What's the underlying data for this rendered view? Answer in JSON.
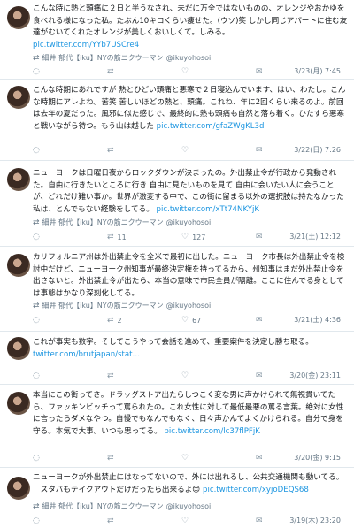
{
  "tweets": [
    {
      "text": "こんな時に熱と頭痛に２日と半うなされ、未だに万全ではないものの、オレンジやおかゆを食べれる様になった私。たぶん10キロくらい痩せた。(ウソ)笑 しかし同じアパートに住む友達がむいてくれたオレンジが美しくおいしくて。しみる。",
      "link": "pic.twitter.com/YYb7USCre4",
      "retweeter": "細井 郁代【iku】NYの筋ニクウーマン",
      "handle": "@ikuyohosoi",
      "date": "3/23(月) 7:45",
      "replies": "",
      "retweets": "",
      "likes": ""
    },
    {
      "text": "こんな時期にあれですが 熱とひどい頭痛と悪寒で２日寝込んでいます、はい、わたし。こんな時期にアレよね。苦笑 苦しいほどの熱と、頭痛。これね、年に2回くらい来るのよ。前回は去年の夏だった。風邪に似た感じで、最終的に熱も頭痛も自然と落ち着く。ひたすら悪寒と戦いながら待つ。もう山は越した ",
      "link": "pic.twitter.com/gfaZWgKL3d",
      "retweeter": "",
      "handle": "",
      "date": "3/22(日) 7:26",
      "replies": "",
      "retweets": "",
      "likes": ""
    },
    {
      "text": "ニューヨークは日曜日夜からロックダウンが決まったの。外出禁止令が行政から発動された。自由に行きたいところに行き 自由に見たいものを見て 自由に会いたい人に会うことが、どれだけ難い事か。世界が激変する中で、この街に留まる以外の選択肢は持たなかった私は、とんでもない経験をしてる。 ",
      "link": "pic.twitter.com/xTt74NKYjK",
      "retweeter": "細井 郁代【iku】NYの筋ニクウーマン",
      "handle": "@ikuyohosoi",
      "date": "3/21(土) 12:12",
      "replies": "",
      "retweets": "11",
      "likes": "127"
    },
    {
      "text": "カリフォルニア州は外出禁止令を全米で最初に出した。ニューヨーク市長は外出禁止令を検討中だけど、ニューヨーク州知事が最終決定権を持ってるから、州知事はまだ外出禁止令を出さないと。外出禁止令が出たら、本当の意味で市民全員が隔離。ここに住んでる身としては事態はかなり深刻化してる。",
      "link": "",
      "retweeter": "細井 郁代【iku】NYの筋ニクウーマン",
      "handle": "@ikuyohosoi",
      "date": "3/21(土) 4:36",
      "replies": "",
      "retweets": "2",
      "likes": "67"
    },
    {
      "text": "これが事実も数字。そしてこうやって会話を進めて、重要案件を決定し勝ち取る。",
      "link": "twitter.com/brutjapan/stat…",
      "retweeter": "",
      "handle": "",
      "date": "3/20(金) 23:11",
      "replies": "",
      "retweets": "",
      "likes": ""
    },
    {
      "text": "本当にこの街ってさ。ドラッグストア出たらしつこく変な男に声かけられて無視貫いてたら、ファッキンビッチって罵られたの。これ女性に対して最低最悪の罵る言葉。絶対に女性に言ったらダメなやつ。自慢でもなんでもなく、日々声かんてよくかけられる。自分で身を守る。本気で大事。いつも思ってる。 ",
      "link": "pic.twitter.com/lc37flPFjK",
      "retweeter": "",
      "handle": "",
      "date": "3/20(金) 9:15",
      "replies": "",
      "retweets": "",
      "likes": ""
    },
    {
      "text": "ニューヨークが外出禁止にはなってないので、外には出れるし、公共交通機関も動いてる。\n　スタバもテイクアウトだけだったら出来るよ😊 ",
      "link": "pic.twitter.com/xyjoDEQS68",
      "retweeter": "細井 郁代【iku】NYの筋ニクウーマン",
      "handle": "@ikuyohosoi",
      "date": "3/19(木) 23:20",
      "replies": "",
      "retweets": "",
      "likes": ""
    }
  ],
  "icons": {
    "retweet": "⇄",
    "reply": "💬",
    "like": "♡",
    "share": "⇪",
    "mail": "✉"
  }
}
